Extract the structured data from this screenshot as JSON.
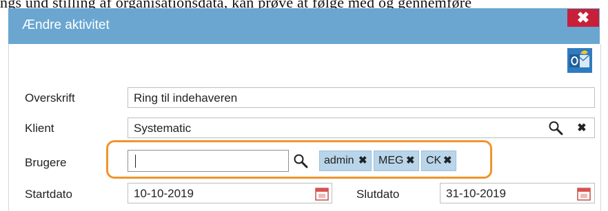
{
  "top_strip": {
    "text": "ngs und stilling af organisationsdata, kan prøve at følge med og gennemføre"
  },
  "dialog": {
    "title": "Ændre aktivitet",
    "close_glyph": "✖"
  },
  "form": {
    "overskrift": {
      "label": "Overskrift",
      "value": "Ring til indehaveren"
    },
    "klient": {
      "label": "Klient",
      "value": "Systematic"
    },
    "brugere": {
      "label": "Brugere",
      "input_value": ""
    },
    "tags": [
      {
        "label": "admin"
      },
      {
        "label": "MEG"
      },
      {
        "label": "CK"
      }
    ],
    "startdato": {
      "label": "Startdato",
      "value": "10-10-2019"
    },
    "slutdato": {
      "label": "Slutdato",
      "value": "31-10-2019"
    }
  },
  "icons": {
    "outlook": "outlook-icon",
    "search": "search-icon",
    "clear": "close-icon",
    "calendar": "calendar-icon"
  },
  "colors": {
    "titlebar": "#6aa6d0",
    "close": "#c8203a",
    "tag_bg": "#b9d5ea",
    "highlight": "#f0942b"
  }
}
